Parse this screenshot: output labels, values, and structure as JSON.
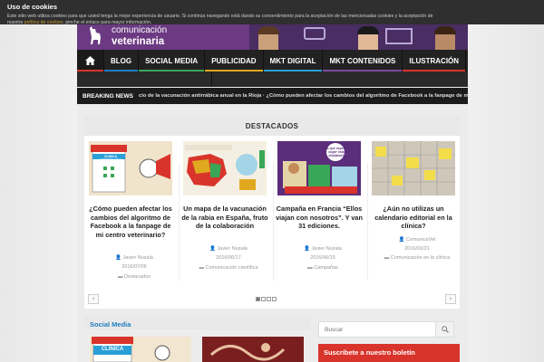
{
  "cookie": {
    "title": "Uso de cookies",
    "text": "Este sitio web utiliza cookies para que usted tenga la mejor experiencia de usuario. Si continúa navegando está dando su consentimiento para la aceptación de las mencionadas cookies y la aceptación de nuestra",
    "link": "política de cookies",
    "text_end": ", pinche el enlace para mayor información."
  },
  "header": {
    "logo_line1": "comunicación",
    "logo_line2": "veterinaria"
  },
  "nav": {
    "items": [
      {
        "label": "BLOG",
        "color": "#1f7fbf"
      },
      {
        "label": "SOCIAL MEDIA",
        "color": "#3aa657"
      },
      {
        "label": "PUBLICIDAD",
        "color": "#e0a81e"
      },
      {
        "label": "MKT DIGITAL",
        "color": "#2a9fd6"
      },
      {
        "label": "MKT CONTENIDOS",
        "color": "#7a4b9c"
      },
      {
        "label": "ILUSTRACIÓN",
        "color": "#d9342b"
      }
    ]
  },
  "breaking": {
    "label": "BREAKING NEWS",
    "ticker": "cio de la vacunación antirrábica anual en la Rioja  ·  ¿Cómo pueden afectar los cambios del algoritmo de Facebook a la fanpage de mi centro veterinario?"
  },
  "featured": {
    "heading": "DESTACADOS",
    "cards": [
      {
        "title": "¿Cómo pueden afectar los cambios del algoritmo de Facebook a la fanpage de mi centro veterinario?",
        "author": "Javier Nuzala",
        "date": "2016/07/06",
        "category": "Destacados"
      },
      {
        "title": "Un mapa de la vacunación de la rabia en España, fruto de la colaboración",
        "author": "Javier Nuzala",
        "date": "2016/06/17",
        "category": "Comunicación científica"
      },
      {
        "title": "Campaña en Francia “Ellos viajan con nosotros”. Y van 31 ediciones.",
        "author": "Javier Nuzala",
        "date": "2016/06/15",
        "category": "Campañas"
      },
      {
        "title": "¿Aún no utilizas un calendario editorial en la clínica?",
        "author": "ComunicaVet",
        "date": "2016/03/21",
        "category": "Comunicación en la clínica"
      }
    ],
    "prev": "‹",
    "next": "›",
    "pages": 4,
    "active_page": 1,
    "thumb1_label": "CLÍNICA VETERINARIA",
    "thumb3_label": "¿A qué esperas coger esta iniciativa?"
  },
  "social": {
    "heading": "Social Media",
    "thumb_label": "CLÍNICA"
  },
  "sidebar": {
    "search_placeholder": "Buscar",
    "subscribe": "Suscríbete a nuestro boletín"
  }
}
